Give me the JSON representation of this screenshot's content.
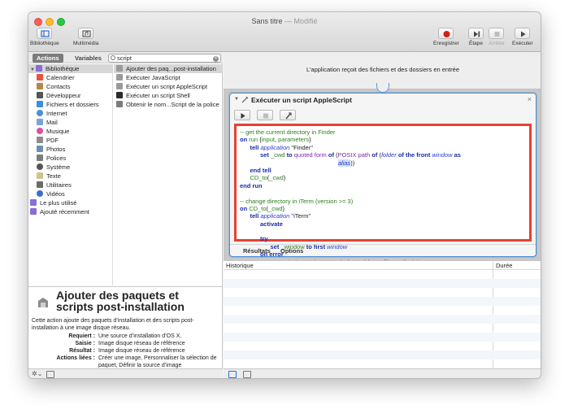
{
  "window": {
    "title": "Sans titre",
    "title_suffix": "— Modifié"
  },
  "toolbar": {
    "left": [
      {
        "label": "Bibliothèque",
        "icon": "library-sidebar-icon"
      },
      {
        "label": "Multimédia",
        "icon": "media-icon"
      }
    ],
    "right": [
      {
        "label": "Enregistrer",
        "icon": "record-icon",
        "enabled": true
      },
      {
        "label": "Étape",
        "icon": "step-icon",
        "enabled": true
      },
      {
        "label": "Arrêter",
        "icon": "stop-icon",
        "enabled": false
      },
      {
        "label": "Exécuter",
        "icon": "play-icon",
        "enabled": true
      }
    ]
  },
  "library": {
    "tabs": {
      "actions": "Actions",
      "variables": "Variables"
    },
    "search": {
      "value": "script",
      "placeholder": "Rechercher"
    },
    "categories": [
      {
        "label": "Bibliothèque",
        "icon": "library-icon",
        "color": "#8b6bd6",
        "level": 0,
        "expanded": true,
        "selected": true
      },
      {
        "label": "Calendrier",
        "icon": "calendar-icon",
        "color": "#e9533f",
        "level": 1
      },
      {
        "label": "Contacts",
        "icon": "contacts-icon",
        "color": "#b08a4a",
        "level": 1
      },
      {
        "label": "Développeur",
        "icon": "developer-icon",
        "color": "#555555",
        "level": 1
      },
      {
        "label": "Fichiers et dossiers",
        "icon": "finder-icon",
        "color": "#3b8fe0",
        "level": 1
      },
      {
        "label": "Internet",
        "icon": "internet-icon",
        "color": "#4a90d9",
        "level": 1
      },
      {
        "label": "Mail",
        "icon": "mail-icon",
        "color": "#7aa4d6",
        "level": 1
      },
      {
        "label": "Musique",
        "icon": "music-icon",
        "color": "#e04fa0",
        "level": 1
      },
      {
        "label": "PDF",
        "icon": "pdf-icon",
        "color": "#8c8c8c",
        "level": 1
      },
      {
        "label": "Photos",
        "icon": "photos-icon",
        "color": "#6f8fb0",
        "level": 1
      },
      {
        "label": "Polices",
        "icon": "fonts-icon",
        "color": "#7c7c7c",
        "level": 1
      },
      {
        "label": "Système",
        "icon": "system-icon",
        "color": "#555555",
        "level": 1
      },
      {
        "label": "Texte",
        "icon": "text-icon",
        "color": "#d0c48c",
        "level": 1
      },
      {
        "label": "Utilitaires",
        "icon": "utilities-icon",
        "color": "#6a6a6a",
        "level": 1
      },
      {
        "label": "Vidéos",
        "icon": "videos-icon",
        "color": "#3a6fc4",
        "level": 1
      },
      {
        "label": "Le plus utilisé",
        "icon": "folder-icon",
        "color": "#8b6bd6",
        "level": 0
      },
      {
        "label": "Ajouté récemment",
        "icon": "folder-icon",
        "color": "#8b6bd6",
        "level": 0
      }
    ],
    "actions": [
      {
        "label": "Ajouter des paq...post-installation",
        "icon": "installer-icon",
        "selected": true
      },
      {
        "label": "Exécuter JavaScript",
        "icon": "script-icon"
      },
      {
        "label": "Exécuter un script AppleScript",
        "icon": "script-icon"
      },
      {
        "label": "Exécuter un script Shell",
        "icon": "terminal-icon"
      },
      {
        "label": "Obtenir le nom...Script de la police",
        "icon": "fonts-icon"
      }
    ]
  },
  "description": {
    "title": "Ajouter des paquets et scripts post-installation",
    "text": "Cette action ajoute des paquets d’installation et des scripts post-installation à une image disque réseau.",
    "fields": [
      {
        "key": "Requiert :",
        "value": "Une source d’installation d’OS X."
      },
      {
        "key": "Saisie :",
        "value": "Image disque réseau de référence"
      },
      {
        "key": "Résultat :",
        "value": "Image disque réseau de référence"
      },
      {
        "key": "Actions liées :",
        "value": "Créer une image, Personnaliser la sélection de paquet, Définir la source d’image"
      }
    ]
  },
  "workflow": {
    "input_text": "L’application reçoit des fichiers et des dossiers en entrée",
    "action_title": "Exécuter un script AppleScript",
    "tabs": [
      "Résultats",
      "Options"
    ]
  },
  "log": {
    "columns": [
      "Historique",
      "Durée"
    ]
  }
}
